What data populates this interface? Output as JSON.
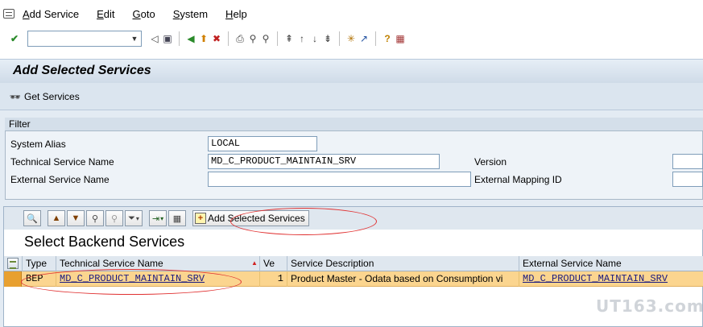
{
  "menu": {
    "items": [
      {
        "u": "A",
        "rest": "dd Service"
      },
      {
        "u": "E",
        "rest": "dit"
      },
      {
        "u": "G",
        "rest": "oto"
      },
      {
        "u": "S",
        "rest": "ystem"
      },
      {
        "u": "H",
        "rest": "elp"
      }
    ]
  },
  "toolbar": {
    "command_field_value": "",
    "icons": [
      "enter-icon",
      "back-icon",
      "save-icon",
      "green-back-icon",
      "exit-icon",
      "cancel-icon",
      "print-icon",
      "find-icon",
      "find-next-icon",
      "first-page-icon",
      "prev-page-icon",
      "next-page-icon",
      "last-page-icon",
      "new-session-icon",
      "shortcut-icon",
      "help-icon",
      "layout-icon"
    ]
  },
  "page": {
    "title": "Add Selected Services",
    "get_services_label": "Get Services"
  },
  "filter": {
    "title": "Filter",
    "system_alias_label": "System Alias",
    "system_alias_value": "LOCAL",
    "technical_service_name_label": "Technical Service Name",
    "technical_service_name_value": "MD_C_PRODUCT_MAINTAIN_SRV",
    "external_service_name_label": "External Service Name",
    "external_service_name_value": "",
    "version_label": "Version",
    "version_value": "",
    "external_mapping_id_label": "External Mapping ID",
    "external_mapping_id_value": ""
  },
  "alv": {
    "add_selected_services_label": "Add Selected Services",
    "grid_title": "Select Backend Services",
    "columns": [
      "Type",
      "Technical Service Name",
      "Ve",
      "Service Description",
      "External Service Name"
    ],
    "rows": [
      {
        "type": "BEP",
        "technical_service_name": "MD_C_PRODUCT_MAINTAIN_SRV",
        "version": "1",
        "service_description": "Product Master - Odata based on Consumption vi",
        "external_service_name": "MD_C_PRODUCT_MAINTAIN_SRV"
      }
    ]
  },
  "watermark": "UT163.com",
  "colors": {
    "selected_row": "#fbd58f",
    "highlight_ellipse": "#e03030"
  }
}
